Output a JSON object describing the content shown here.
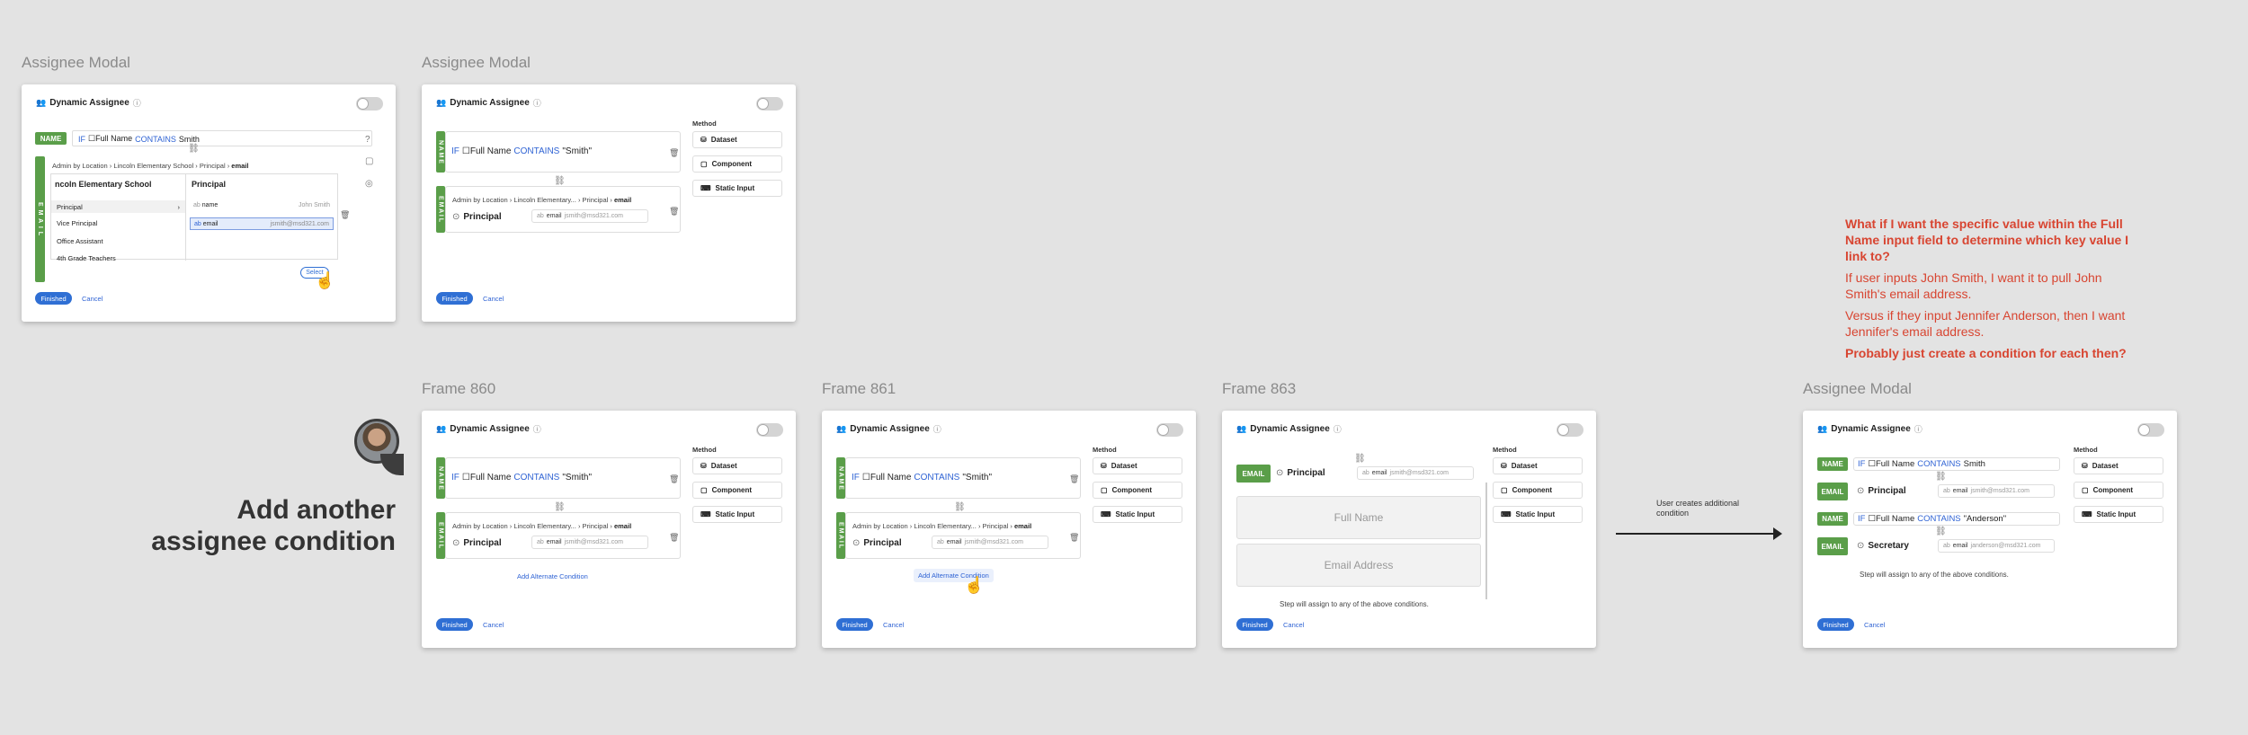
{
  "frame_labels": {
    "f1": "Assignee Modal",
    "f2": "Assignee Modal",
    "f3": "Frame 860",
    "f4": "Frame 861",
    "f5": "Frame 863",
    "f6": "Assignee Modal"
  },
  "modal": {
    "title": "Dynamic Assignee",
    "finished": "Finished",
    "cancel": "Cancel",
    "method": "Method",
    "dataset": "Dataset",
    "component": "Component",
    "static_input": "Static Input"
  },
  "tags": {
    "name": "NAME",
    "email": "EMAIL",
    "name_vert": "N A M E",
    "email_vert": "E M A I L"
  },
  "cond": {
    "if": "IF",
    "field": "☐Full Name",
    "contains": "CONTAINS",
    "smith": "Smith",
    "smith_q": "\"Smith\"",
    "anderson": "\"Anderson\""
  },
  "crumb": {
    "a": "Admin by Location",
    "b": "Lincoln Elementary School",
    "b_short": "Lincoln Elementary...",
    "c": "Principal",
    "d": "email"
  },
  "f1": {
    "col1_title": "ncoln Elementary School",
    "col2_title": "Principal",
    "items": [
      "Principal",
      "Vice Principal",
      "Office Assistant",
      "4th Grade Teachers"
    ],
    "fields": [
      {
        "name": "name",
        "value": "John Smith"
      },
      {
        "name": "email",
        "value": "jsmith@msd321.com"
      }
    ],
    "select": "Select"
  },
  "principal": "Principal",
  "secretary": "Secretary",
  "email_chip": {
    "field": "email",
    "val": "jsmith@msd321.com",
    "val2": "janderson@msd321.com"
  },
  "add_alt": "Add Alternate Condition",
  "f5": {
    "full_name": "Full Name",
    "email_address": "Email Address",
    "note": "Step will assign to any of the above conditions."
  },
  "arrow_label": "User creates additional condition",
  "big_text": "Add another assignee condition",
  "notes": {
    "q": "What if I want the specific value within the Full Name input field to determine which key value I link to?",
    "p1": "If user inputs John Smith, I want it to pull John Smith's email address.",
    "p2": "Versus if they input Jennifer Anderson, then I want Jennifer's email address.",
    "p3": "Probably just create a condition for each then?"
  },
  "colors": {
    "green": "#5a9e49",
    "blue": "#2f6fd4",
    "red": "#d84531"
  }
}
